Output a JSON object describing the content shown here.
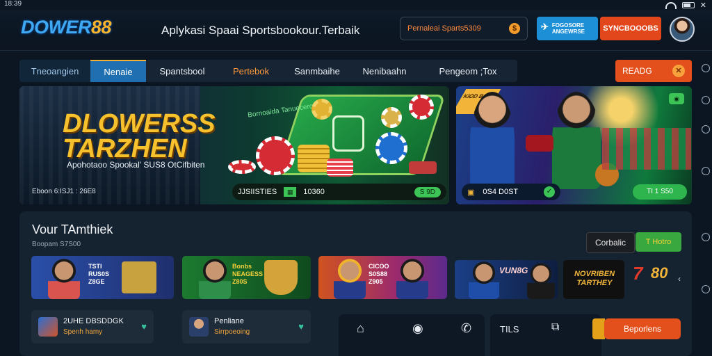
{
  "status": {
    "time": "18:39"
  },
  "header": {
    "logo_main": "DOWER",
    "logo_num": "88",
    "tagline": "Aplykasi Spaai Sportsbookour.Terbaik",
    "promo_text": "Pernaleai  Sparts5309",
    "promo_icon": "coin-icon",
    "app_button": "FOGOSORE ANGEWRSE",
    "signup_button": "SYNCBOOOBS"
  },
  "nav": {
    "items": [
      "Tneoangien",
      "Nenaie",
      "Spantsbool",
      "Pertebok",
      "Sanmbaihe",
      "Nenibaahn",
      "Pengeom ;Tox"
    ],
    "read_button": "READG",
    "read_icon": "close-circle-icon"
  },
  "banner1": {
    "title_line1": "DLOWERSS",
    "title_line2": "TARZHEN",
    "subtitle": "Apohotaoo Spookal' SUS8 OtCifbiten",
    "small_text": "Eboon 6:ISJ1 : 26E8",
    "table_label": "Bornoaida Tanuecero",
    "bar_label": "JJSIISTIES",
    "bar_amount": "10360",
    "bar_pill": "S 9D"
  },
  "banner2": {
    "ribbon": "KIOD BOPS",
    "bar_label": "0S4 D0ST",
    "pill": "TI 1 S50"
  },
  "carousel": {
    "dots": 5,
    "active": 0
  },
  "section": {
    "title": "Vour TAmthiek",
    "subtitle": "Boopam S7S00",
    "filter_a": "Corbalic",
    "filter_b": "T Hotro",
    "cards": [
      {
        "text": "TSTI RUS0S Z8GE"
      },
      {
        "text": "Bonbs NEAGESS Z80S"
      },
      {
        "text": "CICOO S0S88 Z905"
      },
      {
        "text": "VUN8G"
      },
      {
        "text": "NOVRIBEN TARTHEY"
      },
      {
        "text": "80"
      }
    ],
    "mini": [
      {
        "title": "2UHE DBSDDGK",
        "sub": "Spenh hamy"
      },
      {
        "title": "Penliane",
        "sub": "Sirrpoeoing"
      }
    ],
    "dock_label": "TILS",
    "deposit_button": "Beporlens"
  }
}
